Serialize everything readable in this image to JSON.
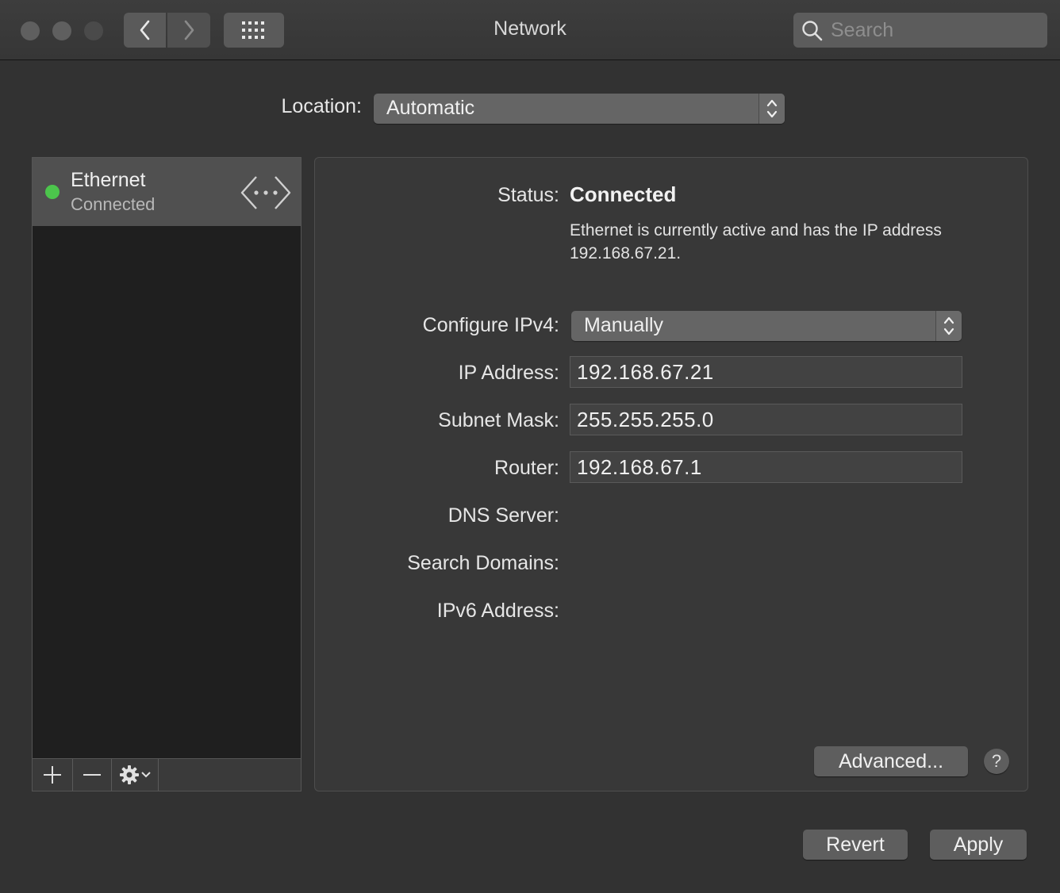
{
  "window": {
    "title": "Network"
  },
  "toolbar": {
    "search_placeholder": "Search"
  },
  "location": {
    "label": "Location:",
    "value": "Automatic"
  },
  "sidebar": {
    "services": [
      {
        "name": "Ethernet",
        "status": "Connected",
        "status_color": "#4cc54c"
      }
    ]
  },
  "detail": {
    "status_label": "Status:",
    "status_value": "Connected",
    "status_description": "Ethernet is currently active and has the IP address 192.168.67.21.",
    "configure_label": "Configure IPv4:",
    "configure_value": "Manually",
    "ip_label": "IP Address:",
    "ip_value": "192.168.67.21",
    "subnet_label": "Subnet Mask:",
    "subnet_value": "255.255.255.0",
    "router_label": "Router:",
    "router_value": "192.168.67.1",
    "dns_label": "DNS Server:",
    "search_domains_label": "Search Domains:",
    "ipv6_label": "IPv6 Address:",
    "advanced_label": "Advanced...",
    "help_label": "?"
  },
  "footer": {
    "revert_label": "Revert",
    "apply_label": "Apply"
  }
}
